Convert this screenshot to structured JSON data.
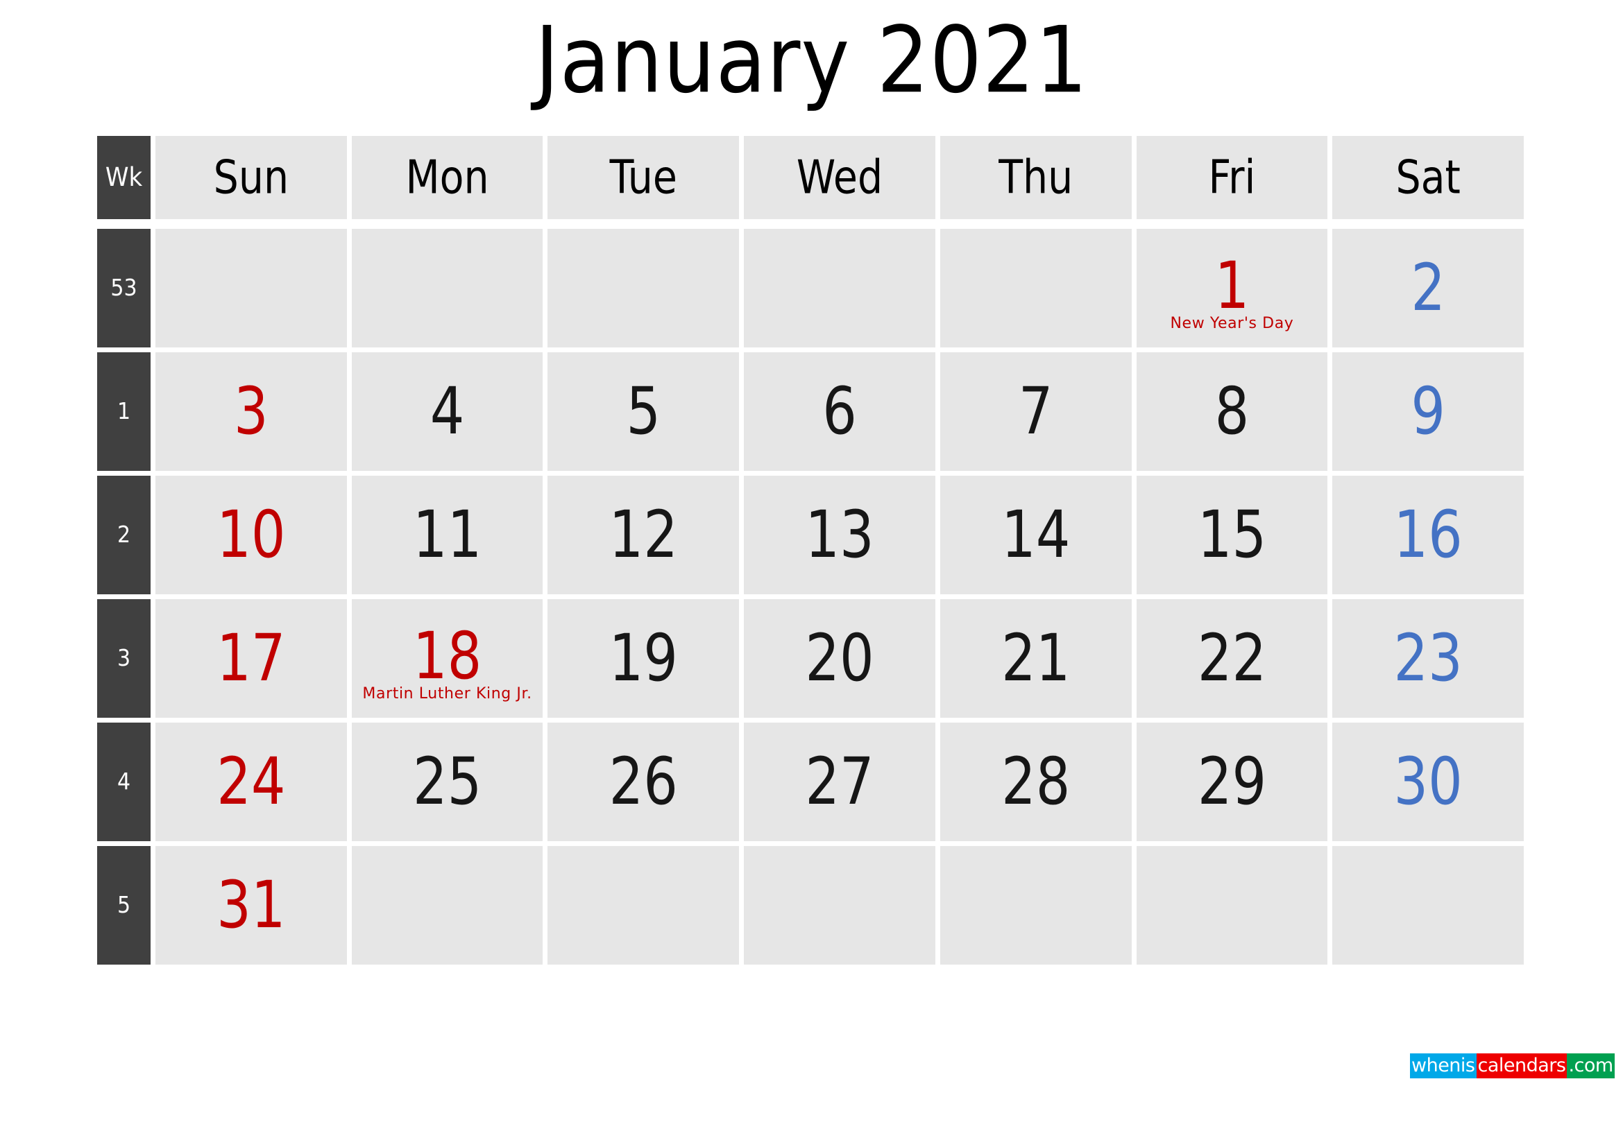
{
  "title": "January 2021",
  "grid": {
    "week_header_label": "Wk",
    "day_headers": [
      "Sun",
      "Mon",
      "Tue",
      "Wed",
      "Thu",
      "Fri",
      "Sat"
    ],
    "weeks": [
      {
        "week_number": "53",
        "days": [
          {
            "num": "",
            "kind": "empty"
          },
          {
            "num": "",
            "kind": "empty"
          },
          {
            "num": "",
            "kind": "empty"
          },
          {
            "num": "",
            "kind": "empty"
          },
          {
            "num": "",
            "kind": "empty"
          },
          {
            "num": "1",
            "kind": "holiday",
            "event": "New Year's Day"
          },
          {
            "num": "2",
            "kind": "sat"
          }
        ]
      },
      {
        "week_number": "1",
        "days": [
          {
            "num": "3",
            "kind": "sun"
          },
          {
            "num": "4",
            "kind": "weekday"
          },
          {
            "num": "5",
            "kind": "weekday"
          },
          {
            "num": "6",
            "kind": "weekday"
          },
          {
            "num": "7",
            "kind": "weekday"
          },
          {
            "num": "8",
            "kind": "weekday"
          },
          {
            "num": "9",
            "kind": "sat"
          }
        ]
      },
      {
        "week_number": "2",
        "days": [
          {
            "num": "10",
            "kind": "sun"
          },
          {
            "num": "11",
            "kind": "weekday"
          },
          {
            "num": "12",
            "kind": "weekday"
          },
          {
            "num": "13",
            "kind": "weekday"
          },
          {
            "num": "14",
            "kind": "weekday"
          },
          {
            "num": "15",
            "kind": "weekday"
          },
          {
            "num": "16",
            "kind": "sat"
          }
        ]
      },
      {
        "week_number": "3",
        "days": [
          {
            "num": "17",
            "kind": "sun"
          },
          {
            "num": "18",
            "kind": "holiday",
            "event": "Martin Luther King Jr."
          },
          {
            "num": "19",
            "kind": "weekday"
          },
          {
            "num": "20",
            "kind": "weekday"
          },
          {
            "num": "21",
            "kind": "weekday"
          },
          {
            "num": "22",
            "kind": "weekday"
          },
          {
            "num": "23",
            "kind": "sat"
          }
        ]
      },
      {
        "week_number": "4",
        "days": [
          {
            "num": "24",
            "kind": "sun"
          },
          {
            "num": "25",
            "kind": "weekday"
          },
          {
            "num": "26",
            "kind": "weekday"
          },
          {
            "num": "27",
            "kind": "weekday"
          },
          {
            "num": "28",
            "kind": "weekday"
          },
          {
            "num": "29",
            "kind": "weekday"
          },
          {
            "num": "30",
            "kind": "sat"
          }
        ]
      },
      {
        "week_number": "5",
        "days": [
          {
            "num": "31",
            "kind": "sun"
          },
          {
            "num": "",
            "kind": "empty"
          },
          {
            "num": "",
            "kind": "empty"
          },
          {
            "num": "",
            "kind": "empty"
          },
          {
            "num": "",
            "kind": "empty"
          },
          {
            "num": "",
            "kind": "empty"
          },
          {
            "num": "",
            "kind": "empty"
          }
        ]
      }
    ]
  },
  "logo": {
    "segment_1": "whenis",
    "segment_2": "calendars",
    "segment_3": ".com"
  },
  "colors": {
    "sunday": "#c00000",
    "saturday": "#4472c4",
    "weekday": "#161616",
    "holiday": "#c00000",
    "cell_background": "#e6e6e6",
    "week_column": "#404040",
    "page_background": "#ffffff",
    "logo_blue": "#00a8e8",
    "logo_red": "#ee0000",
    "logo_green": "#00a050"
  }
}
